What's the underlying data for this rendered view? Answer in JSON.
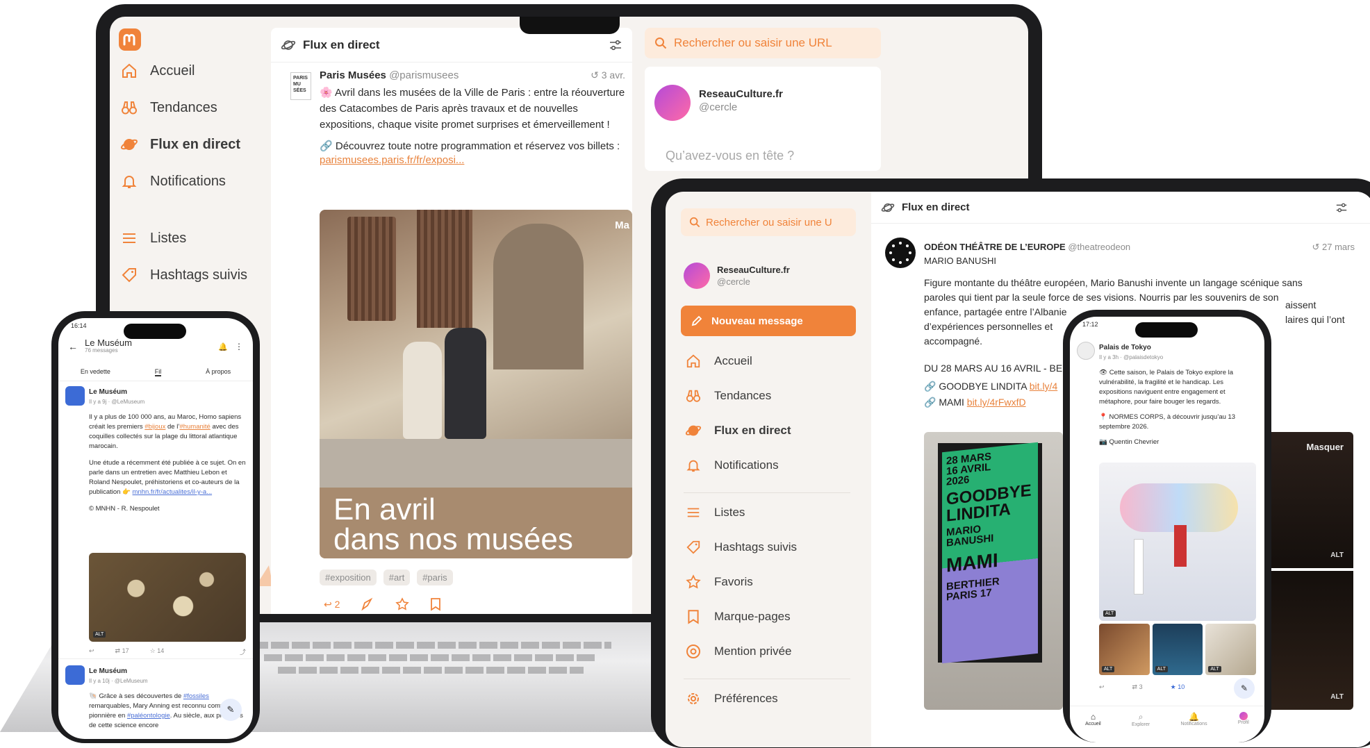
{
  "laptop": {
    "nav": [
      {
        "label": "Accueil",
        "icon": "home-icon"
      },
      {
        "label": "Tendances",
        "icon": "binoculars-icon"
      },
      {
        "label": "Flux en direct",
        "icon": "planet-icon"
      },
      {
        "label": "Notifications",
        "icon": "bell-icon"
      },
      {
        "label": "Listes",
        "icon": "list-icon"
      },
      {
        "label": "Hashtags suivis",
        "icon": "hashtag-icon"
      }
    ],
    "column_title": "Flux en direct",
    "search_placeholder": "Rechercher ou saisir une URL",
    "account": {
      "name": "ReseauCulture.fr",
      "handle": "@cercle"
    },
    "compose_placeholder": "Qu’avez-vous en tête ?",
    "post": {
      "author": "Paris Musées",
      "handle": "@parismusees",
      "time": "3 avr.",
      "avatar_text": "PARIS MU SÉES",
      "text": "Avril dans les musées de la Ville de Paris : entre la réouverture des Catacombes de Paris après travaux et de nouvelles expositions, chaque visite promet surprises et émerveillement !",
      "text2": "Découvrez toute notre programmation et réservez vos billets :",
      "link": "parismusees.paris.fr/fr/exposi...",
      "image_caption_1": "En avril",
      "image_caption_2": "dans nos musées",
      "image_corner": "Ma",
      "tags": [
        "#exposition",
        "#art",
        "#paris"
      ],
      "reply_count": "2"
    }
  },
  "tablet": {
    "search_placeholder": "Rechercher ou saisir une U",
    "account": {
      "name": "ReseauCulture.fr",
      "handle": "@cercle"
    },
    "new_post_button": "Nouveau message",
    "nav": [
      {
        "label": "Accueil",
        "icon": "home-icon"
      },
      {
        "label": "Tendances",
        "icon": "binoculars-icon"
      },
      {
        "label": "Flux en direct",
        "icon": "planet-icon"
      },
      {
        "label": "Notifications",
        "icon": "bell-icon"
      },
      {
        "label": "Listes",
        "icon": "list-icon"
      },
      {
        "label": "Hashtags suivis",
        "icon": "hashtag-icon"
      },
      {
        "label": "Favoris",
        "icon": "star-icon"
      },
      {
        "label": "Marque-pages",
        "icon": "bookmark-icon"
      },
      {
        "label": "Mention privée",
        "icon": "at-icon"
      },
      {
        "label": "Préférences",
        "icon": "gear-icon"
      }
    ],
    "column_title": "Flux en direct",
    "post": {
      "author": "ODÉON THÉÂTRE DE L’EUROPE",
      "handle": "@theatreodeon",
      "time": "27 mars",
      "subtitle": "MARIO BANUSHI",
      "text_lines": [
        "Figure montante du théâtre européen, Mario Banushi invente un langage scénique sans",
        "paroles qui tient par la seule force de ses visions. Nourris par les souvenirs de son",
        "enfance, partagée entre l’Albanie",
        "d’expériences personnelles et",
        "accompagné."
      ],
      "text_tail_1": "aissent",
      "text_tail_2": "laires qui l’ont",
      "dates": "DU 28 MARS AU 16 AVRIL - BE",
      "link1_label": "GOODBYE LINDITA",
      "link1": "bit.ly/4",
      "link2_label": "MAMI",
      "link2": "bit.ly/4rFwxfD",
      "poster_lines": [
        "28 MARS",
        "16 AVRIL",
        "2026",
        "GOODBYE",
        "LINDITA",
        "MARIO",
        "BANUSHI",
        "MAMI",
        "BERTHIER",
        "PARIS 17"
      ],
      "side_label": "Masquer",
      "alt": "ALT"
    }
  },
  "phone_left": {
    "time": "16:14",
    "title": "Le Muséum",
    "subtitle": "76 messages",
    "tabs": [
      "En vedette",
      "Fil",
      "À propos"
    ],
    "post1": {
      "author": "Le Muséum",
      "meta": "Il y a 9j · @LeMuseum",
      "p1_a": "Il y a plus de 100 000 ans, au Maroc, Homo sapiens créait les premiers ",
      "p1_link1": "#bijoux",
      "p1_b": " de l’",
      "p1_link2": "#humanité",
      "p1_c": " avec des coquilles collectés sur la plage du littoral atlantique marocain.",
      "p2_a": "Une étude a récemment été publiée à ce sujet. On en parle dans un entretien avec Matthieu Lebon et Roland Nespoulet, préhistoriens et co-auteurs de la publication 👉 ",
      "p2_link": "mnhn.fr/fr/actualites/il-y-a...",
      "credit": "© MNHN - R. Nespoulet",
      "alt": "ALT",
      "boosts": "17",
      "favs": "14"
    },
    "post2": {
      "author": "Le Muséum",
      "meta": "Il y a 10j · @LeMuseum",
      "p_a": "🐚 Grâce à ses découvertes de ",
      "p_link1": "#fossiles",
      "p_b": " remarquables, Mary Anning est reconnu comme pionnière en ",
      "p_link2": "#paléontologie",
      "p_c": ". Au siècle, aux prémices de cette science encore"
    }
  },
  "phone_right": {
    "time": "17:12",
    "author": "Palais de Tokyo",
    "meta": "Il y a 3h · @palaisdetokyo",
    "p1": "👁 Cette saison, le Palais de Tokyo explore la vulnérabilité, la fragilité et le handicap. Les expositions naviguent entre engagement et métaphore, pour faire bouger les regards.",
    "p2": "📍 NORMES CORPS, à découvrir jusqu’au 13 septembre 2026.",
    "credit": "📷 Quentin Chevrier",
    "alt": "ALT",
    "boosts": "3",
    "favs": "10",
    "tabs": [
      "Accueil",
      "Explorer",
      "Notifications",
      "Profil"
    ]
  },
  "colors": {
    "accent": "#f0833a",
    "accent_dark": "#e8823c",
    "bg": "#f6f3f0",
    "bezel": "#1c1c1e"
  }
}
